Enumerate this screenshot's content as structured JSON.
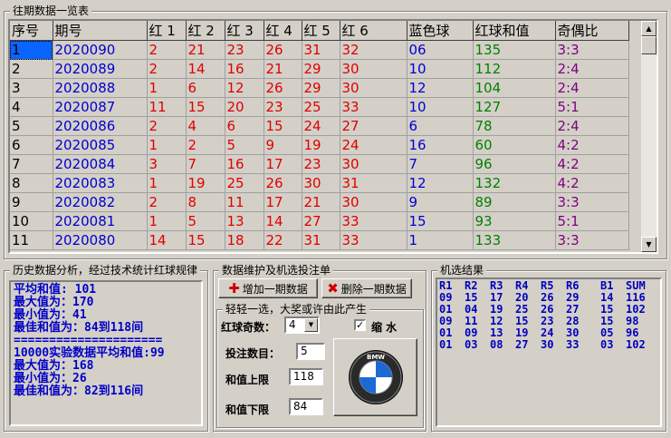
{
  "history_group": {
    "title": "往期数据一览表"
  },
  "table": {
    "headers": [
      "序号",
      "期号",
      "红 1",
      "红 2",
      "红 3",
      "红 4",
      "红 5",
      "红 6",
      "蓝色球",
      "红球和值",
      "奇偶比"
    ],
    "rows": [
      {
        "seq": "1",
        "issue": "2020090",
        "r1": "2",
        "r2": "21",
        "r3": "23",
        "r4": "26",
        "r5": "31",
        "r6": "32",
        "blue": "06",
        "sum": "135",
        "ratio": "3:3"
      },
      {
        "seq": "2",
        "issue": "2020089",
        "r1": "2",
        "r2": "14",
        "r3": "16",
        "r4": "21",
        "r5": "29",
        "r6": "30",
        "blue": "10",
        "sum": "112",
        "ratio": "2:4"
      },
      {
        "seq": "3",
        "issue": "2020088",
        "r1": "1",
        "r2": "6",
        "r3": "12",
        "r4": "26",
        "r5": "29",
        "r6": "30",
        "blue": "12",
        "sum": "104",
        "ratio": "2:4"
      },
      {
        "seq": "4",
        "issue": "2020087",
        "r1": "11",
        "r2": "15",
        "r3": "20",
        "r4": "23",
        "r5": "25",
        "r6": "33",
        "blue": "10",
        "sum": "127",
        "ratio": "5:1"
      },
      {
        "seq": "5",
        "issue": "2020086",
        "r1": "2",
        "r2": "4",
        "r3": "6",
        "r4": "15",
        "r5": "24",
        "r6": "27",
        "blue": "6",
        "sum": "78",
        "ratio": "2:4"
      },
      {
        "seq": "6",
        "issue": "2020085",
        "r1": "1",
        "r2": "2",
        "r3": "5",
        "r4": "9",
        "r5": "19",
        "r6": "24",
        "blue": "16",
        "sum": "60",
        "ratio": "4:2"
      },
      {
        "seq": "7",
        "issue": "2020084",
        "r1": "3",
        "r2": "7",
        "r3": "16",
        "r4": "17",
        "r5": "23",
        "r6": "30",
        "blue": "7",
        "sum": "96",
        "ratio": "4:2"
      },
      {
        "seq": "8",
        "issue": "2020083",
        "r1": "1",
        "r2": "19",
        "r3": "25",
        "r4": "26",
        "r5": "30",
        "r6": "31",
        "blue": "12",
        "sum": "132",
        "ratio": "4:2"
      },
      {
        "seq": "9",
        "issue": "2020082",
        "r1": "2",
        "r2": "8",
        "r3": "11",
        "r4": "17",
        "r5": "21",
        "r6": "30",
        "blue": "9",
        "sum": "89",
        "ratio": "3:3"
      },
      {
        "seq": "10",
        "issue": "2020081",
        "r1": "1",
        "r2": "5",
        "r3": "13",
        "r4": "14",
        "r5": "27",
        "r6": "33",
        "blue": "15",
        "sum": "93",
        "ratio": "5:1"
      },
      {
        "seq": "11",
        "issue": "2020080",
        "r1": "14",
        "r2": "15",
        "r3": "18",
        "r4": "22",
        "r5": "31",
        "r6": "33",
        "blue": "1",
        "sum": "133",
        "ratio": "3:3"
      }
    ]
  },
  "analysis_group": {
    "title": "历史数据分析，经过技术统计红球规律",
    "lines": [
      "平均和值:    101",
      "最大值为：170",
      "最小值为：41",
      "最佳和值为：84到118间",
      "=====================",
      "10000实验数据平均和值:99",
      "最大值为：168",
      "最小值为：26",
      "最佳和值为：82到116间"
    ]
  },
  "maintenance_group": {
    "title": "数据维护及机选投注单",
    "add_button": "增加一期数据",
    "delete_button": "删除一期数据",
    "inner_title": "轻轻一选，大奖或许由此产生",
    "red_count_label": "红球奇数：",
    "red_count_value": "4",
    "shrink_label": "缩 水",
    "shrink_checked": "✓",
    "bets_label": "投注数目：",
    "bets_value": "5",
    "sum_upper_label": "和值上限",
    "sum_upper_value": "118",
    "sum_lower_label": "和值下限",
    "sum_lower_value": "84",
    "logo_letters": "BMW"
  },
  "results_group": {
    "title": "机选结果",
    "headers": [
      "R1",
      "R2",
      "R3",
      "R4",
      "R5",
      "R6",
      "B1",
      "SUM"
    ],
    "rows": [
      [
        "09",
        "15",
        "17",
        "20",
        "26",
        "29",
        "14",
        "116"
      ],
      [
        "01",
        "04",
        "19",
        "25",
        "26",
        "27",
        "15",
        "102"
      ],
      [
        "09",
        "11",
        "12",
        "15",
        "23",
        "28",
        "15",
        "98"
      ],
      [
        "01",
        "09",
        "13",
        "19",
        "24",
        "30",
        "05",
        "96"
      ],
      [
        "01",
        "03",
        "08",
        "27",
        "30",
        "33",
        "03",
        "102"
      ]
    ]
  }
}
